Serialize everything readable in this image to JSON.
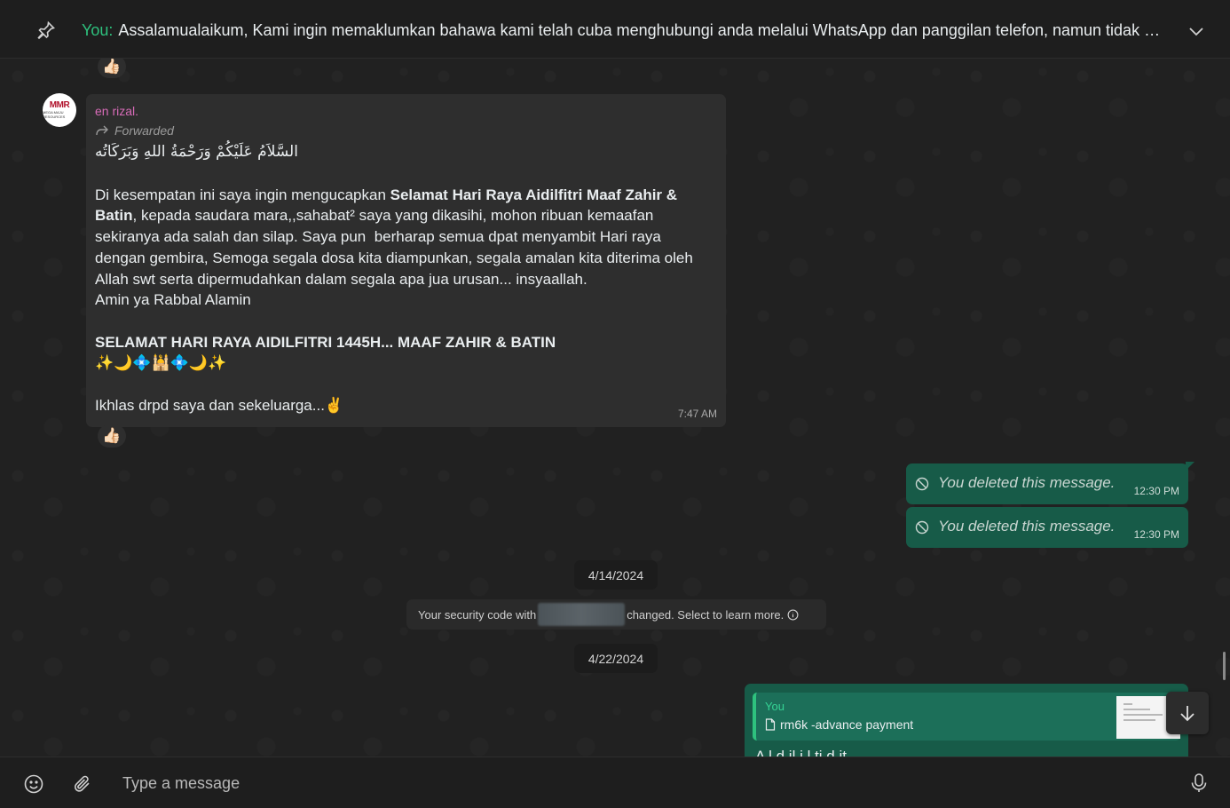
{
  "pinned": {
    "sender": "You:",
    "text": "Assalamualaikum,  Kami ingin memaklumkan bahawa kami telah cuba menghubungi anda melalui WhatsApp dan panggilan telefon, namun tidak mener..."
  },
  "reactions": {
    "top": "👍🏻",
    "incoming": "👍🏻"
  },
  "incoming_message": {
    "avatar_text": "MMR",
    "avatar_sub": "MEGA MAJU RESOURCES",
    "sender": "en rizal.",
    "forwarded_label": "Forwarded",
    "arabic_greeting": "السَّلاَمُ عَلَيْكُمْ وَرَحْمَةُ اللهِ وَبَرَكَاتُه",
    "line1_pre": "Di kesempatan ini saya ingin mengucapkan ",
    "line1_bold": "Selamat Hari Raya Aidilfitri Maaf Zahir &",
    "line2_bold": "Batin",
    "line2_rest": ", kepada saudara mara,,sahabat² saya yang dikasihi, mohon ribuan kemaafan",
    "line3": "sekiranya ada salah dan silap. Saya pun  berharap semua dpat menyambit Hari raya",
    "line4": "dengan gembira, Semoga segala dosa kita diampunkan, segala amalan kita diterima oleh",
    "line5": "Allah swt serta dipermudahkan dalam segala apa jua urusan... insyaallah.",
    "line6": "Amin ya Rabbal Alamin",
    "headline": "SELAMAT HARI RAYA AIDILFITRI 1445H... MAAF ZAHIR & BATIN",
    "emoji_row": "✨🌙💠🕌💠🌙✨",
    "closing": "Ikhlas drpd saya dan sekeluarga...✌️",
    "time": "7:47 AM"
  },
  "deleted_messages": [
    {
      "text": "You deleted this message.",
      "time": "12:30 PM"
    },
    {
      "text": "You deleted this message.",
      "time": "12:30 PM"
    }
  ],
  "dates": {
    "first": "4/14/2024",
    "second": "4/22/2024"
  },
  "security": {
    "prefix": "Your security code with",
    "suffix": "changed. Select to learn more."
  },
  "reply_message": {
    "quoted_author": "You",
    "quoted_file": "rm6k -advance payment",
    "partial_text": "A     l        d    il               i   l        ti              d    it"
  },
  "composer": {
    "placeholder": "Type a message"
  },
  "colors": {
    "accent_green": "#2ec27e",
    "outgoing_bubble": "#175b48",
    "incoming_bubble": "#2e2e2e",
    "sender_name": "#d86bb8"
  },
  "icons": [
    "pin-icon",
    "chevron-down-icon",
    "forward-icon",
    "deleted-icon",
    "info-icon",
    "file-icon",
    "arrow-down-icon",
    "emoji-icon",
    "paperclip-icon",
    "microphone-icon"
  ]
}
